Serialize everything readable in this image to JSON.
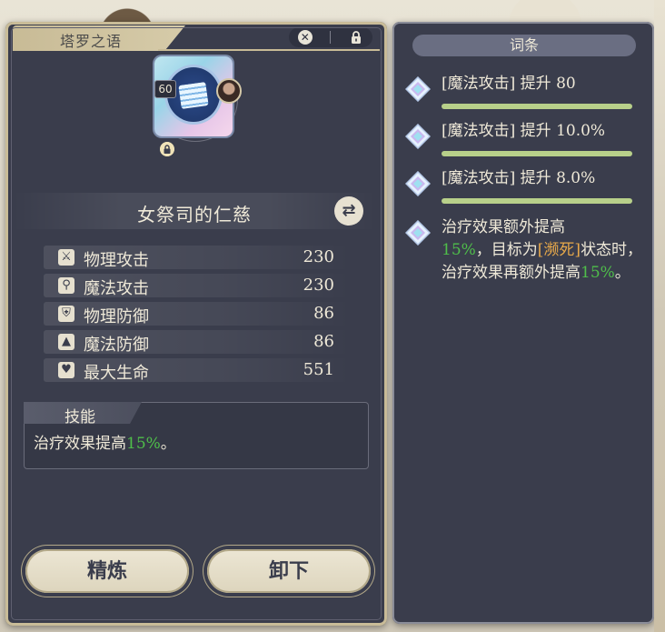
{
  "left_panel": {
    "title": "塔罗之语",
    "close_label": "✕",
    "card": {
      "level": "60",
      "name": "女祭司的仁慈"
    },
    "stats": [
      {
        "icon": "sword-icon",
        "glyph": "⚔",
        "label": "物理攻击",
        "value": "230"
      },
      {
        "icon": "wand-icon",
        "glyph": "⚲",
        "label": "魔法攻击",
        "value": "230"
      },
      {
        "icon": "shield-icon",
        "glyph": "⛨",
        "label": "物理防御",
        "value": "86"
      },
      {
        "icon": "witch-hat-icon",
        "glyph": "▲",
        "label": "魔法防御",
        "value": "86"
      },
      {
        "icon": "heart-icon",
        "glyph": "♥",
        "label": "最大生命",
        "value": "551"
      }
    ],
    "skill": {
      "title": "技能",
      "text_prefix": "治疗效果提高",
      "text_value": "15%",
      "text_suffix": "。"
    },
    "buttons": {
      "refine": "精炼",
      "unequip": "卸下"
    }
  },
  "right_panel": {
    "title": "词条",
    "entries": [
      {
        "text": "[魔法攻击] 提升 80"
      },
      {
        "text": "[魔法攻击] 提升 10.0%"
      },
      {
        "text": "[魔法攻击] 提升 8.0%"
      }
    ],
    "special_entry": {
      "line1": "治疗效果额外提高",
      "value1": "15%",
      "part2": "，目标为",
      "status": "[濒死]",
      "part3": "状态时，治疗效果再额外提高",
      "value2": "15%",
      "end": "。"
    }
  },
  "colors": {
    "panel_bg": "#3a3d4c",
    "accent_gold": "#c8bb96",
    "highlight_green": "#4fbe4a",
    "status_orange": "#e8a94a",
    "bar_green": "#b8d08a"
  }
}
